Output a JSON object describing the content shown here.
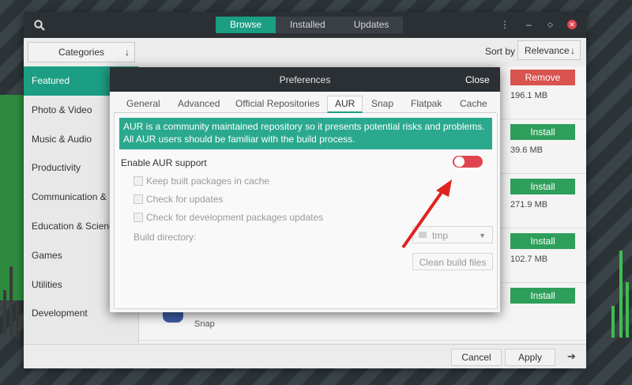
{
  "view_tabs": [
    "Browse",
    "Installed",
    "Updates"
  ],
  "active_view": "Browse",
  "toolbar": {
    "categories_label": "Categories",
    "sort_label": "Sort by",
    "sort_value": "Relevance"
  },
  "sidebar": {
    "items": [
      {
        "label": "Featured"
      },
      {
        "label": "Photo & Video"
      },
      {
        "label": "Music & Audio"
      },
      {
        "label": "Productivity"
      },
      {
        "label": "Communication & N"
      },
      {
        "label": "Education & Scienc"
      },
      {
        "label": "Games"
      },
      {
        "label": "Utilities"
      },
      {
        "label": "Development"
      }
    ],
    "active": "Featured"
  },
  "apps": [
    {
      "button": "Remove",
      "size": "196.1 MB"
    },
    {
      "button": "Install",
      "size": "39.6 MB"
    },
    {
      "button": "Install",
      "size": "271.9 MB"
    },
    {
      "button": "Install",
      "size": "102.7 MB"
    },
    {
      "button": "Install",
      "size": ""
    }
  ],
  "snap_label": "Snap",
  "bottom": {
    "cancel": "Cancel",
    "apply": "Apply"
  },
  "dialog": {
    "title": "Preferences",
    "close": "Close",
    "tabs": [
      "General",
      "Advanced",
      "Official Repositories",
      "AUR",
      "Snap",
      "Flatpak",
      "Cache"
    ],
    "active_tab": "AUR",
    "banner_line1": "AUR is a community maintained repository so it presents potential risks and problems.",
    "banner_line2": "All AUR users should be familiar with the build process.",
    "enable_label": "Enable AUR support",
    "enable_state": false,
    "options": [
      {
        "label": "Keep built packages in cache",
        "checked": false
      },
      {
        "label": "Check for updates",
        "checked": false
      },
      {
        "label": "Check for development packages updates",
        "checked": false
      }
    ],
    "build_dir_label": "Build directory:",
    "build_dir_value": "tmp",
    "clean_button": "Clean build files"
  },
  "colors": {
    "accent": "#1b9e83",
    "toggle_off": "#e0454f",
    "install": "#2e9f5a",
    "remove": "#d9534f",
    "annotation": "#e0221f"
  }
}
